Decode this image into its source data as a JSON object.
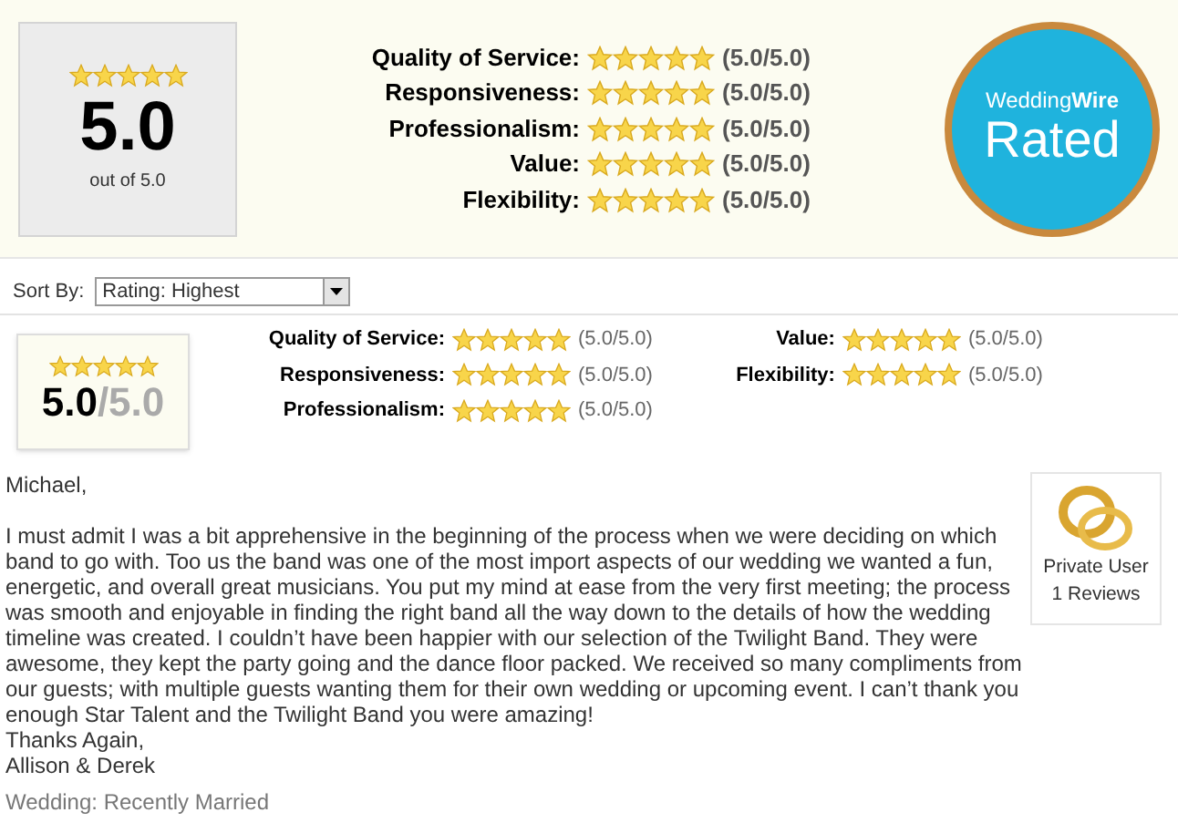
{
  "summary": {
    "stars": 5,
    "score": "5.0",
    "out_of": "out of 5.0",
    "ratings": [
      {
        "label": "Quality of Service:",
        "stars": 5,
        "reading": "(5.0/5.0)"
      },
      {
        "label": "Responsiveness:",
        "stars": 5,
        "reading": "(5.0/5.0)"
      },
      {
        "label": "Professionalism:",
        "stars": 5,
        "reading": "(5.0/5.0)"
      },
      {
        "label": "Value:",
        "stars": 5,
        "reading": "(5.0/5.0)"
      },
      {
        "label": "Flexibility:",
        "stars": 5,
        "reading": "(5.0/5.0)"
      }
    ],
    "badge": {
      "brand_light": "Wedding",
      "brand_bold": "Wire",
      "word": "Rated"
    }
  },
  "sort": {
    "label": "Sort By:",
    "value": "Rating: Highest"
  },
  "review": {
    "stars": 5,
    "score": "5.0",
    "max": "/5.0",
    "ratings": [
      {
        "label": "Quality of Service:",
        "stars": 5,
        "reading": "(5.0/5.0)"
      },
      {
        "label": "Responsiveness:",
        "stars": 5,
        "reading": "(5.0/5.0)"
      },
      {
        "label": "Professionalism:",
        "stars": 5,
        "reading": "(5.0/5.0)"
      },
      {
        "label": "Value:",
        "stars": 5,
        "reading": "(5.0/5.0)"
      },
      {
        "label": "Flexibility:",
        "stars": 5,
        "reading": "(5.0/5.0)"
      }
    ],
    "greeting": "Michael,",
    "body": "I must admit I was a bit apprehensive in the beginning of the process when we were deciding on which band to go with. Too us the band was one of the most import aspects of our wedding we wanted a fun, energetic, and overall great musicians. You put my mind at ease from the very first meeting; the process was smooth and enjoyable in finding the right band all the way down to the details of how the wedding timeline was created. I couldn’t have been happier with our selection of the Twilight Band. They were awesome, they kept the party going and the dance floor packed. We received so many compliments from our guests; with multiple guests wanting them for their own wedding or upcoming event. I can’t thank you enough Star Talent and the Twilight Band you were amazing!",
    "signoff": [
      "Thanks Again,",
      "Allison & Derek"
    ],
    "wedding": "Wedding: Recently Married",
    "user": {
      "name": "Private User",
      "reviews": "1 Reviews"
    }
  }
}
